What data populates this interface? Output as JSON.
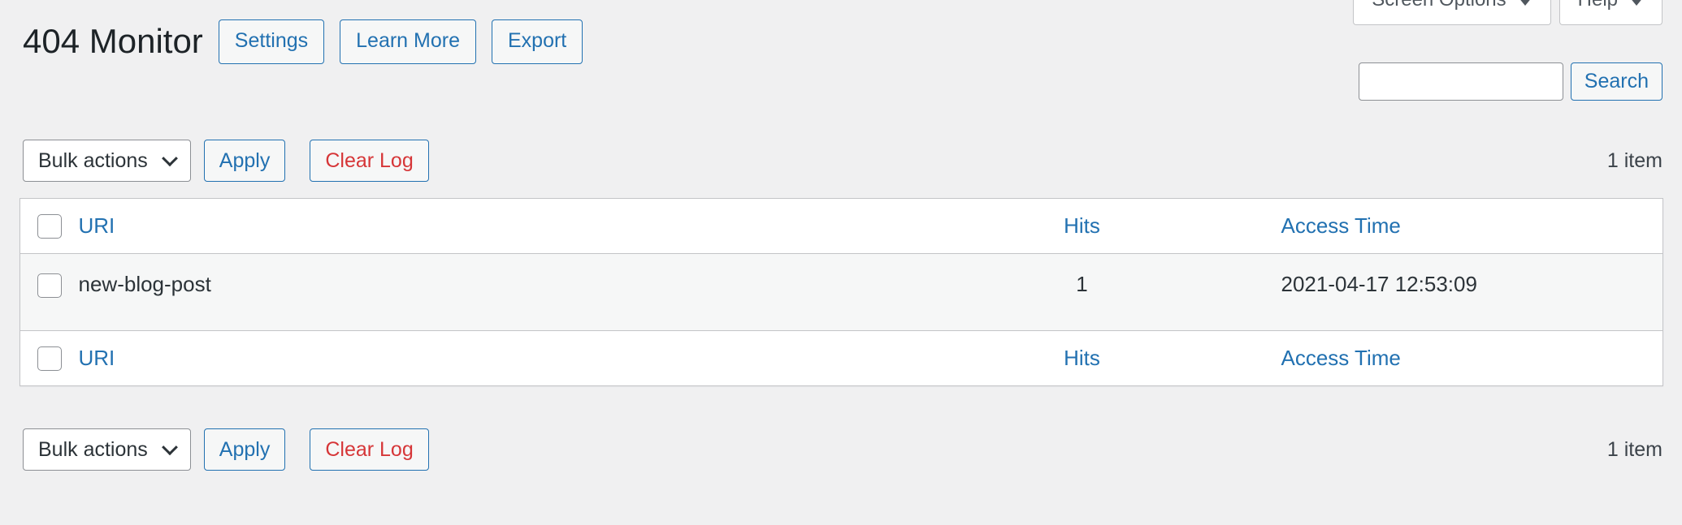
{
  "meta": {
    "screen_options_label": "Screen Options",
    "help_label": "Help",
    "caret_icon": "chevron-down-icon"
  },
  "header": {
    "title": "404 Monitor",
    "buttons": [
      {
        "label": "Settings",
        "style": "link"
      },
      {
        "label": "Learn More",
        "style": "link"
      },
      {
        "label": "Export",
        "style": "link"
      }
    ]
  },
  "search": {
    "value": "",
    "placeholder": "",
    "button_label": "Search"
  },
  "tablenav_top": {
    "bulk_actions_label": "Bulk actions",
    "apply_label": "Apply",
    "clear_log_label": "Clear Log",
    "displaying_num": "1 item"
  },
  "tablenav_bottom": {
    "bulk_actions_label": "Bulk actions",
    "apply_label": "Apply",
    "clear_log_label": "Clear Log",
    "displaying_num": "1 item"
  },
  "table": {
    "columns": {
      "uri": "URI",
      "hits": "Hits",
      "access_time": "Access Time"
    },
    "rows": [
      {
        "uri": "new-blog-post",
        "hits": "1",
        "access_time": "2021-04-17 12:53:09"
      }
    ]
  },
  "colors": {
    "page_background": "#f0f0f1",
    "link_blue": "#2271b1",
    "danger_red": "#d63638",
    "text_dark": "#1d2327",
    "text_body": "#2c3338",
    "border_gray": "#c3c4c7",
    "input_border": "#8c8f94",
    "row_alt_background": "#f6f7f7"
  }
}
